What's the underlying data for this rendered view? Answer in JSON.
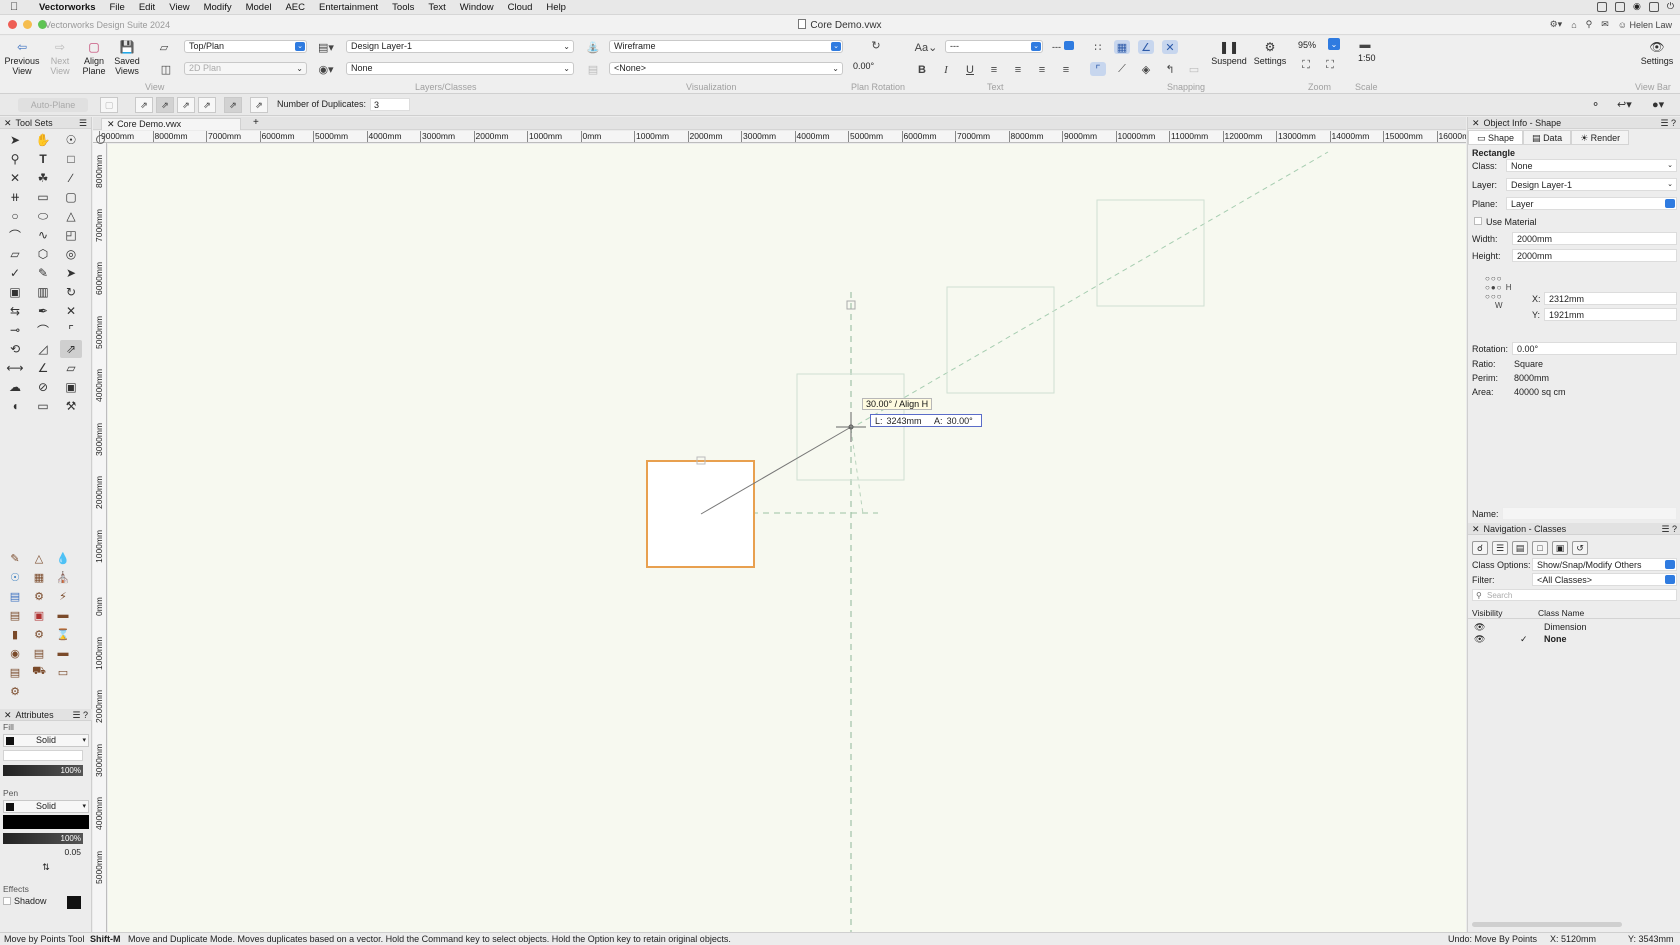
{
  "menubar": {
    "app": "Vectorworks",
    "items": [
      "File",
      "Edit",
      "View",
      "Modify",
      "Model",
      "AEC",
      "Entertainment",
      "Tools",
      "Text",
      "Window",
      "Cloud",
      "Help"
    ]
  },
  "window": {
    "app_name": "Vectorworks Design Suite 2024",
    "doc_title": "Core Demo.vwx",
    "user": "Helen Law"
  },
  "toolbar": {
    "previous_view": "Previous View",
    "next_view": "Next View",
    "align_plane": "Align Plane",
    "saved_views": "Saved Views",
    "view_select": "Top/Plan",
    "plane_select": "2D Plan",
    "layer_select": "Design Layer-1",
    "class_select": "None",
    "render_select": "Wireframe",
    "viewport_select": "<None>",
    "plan_rotation": "0.00°",
    "text_style": "---",
    "text_size": "---",
    "suspend": "Suspend",
    "settings": "Settings",
    "zoom_value": "95%",
    "scale_value": "1:50",
    "settings_right": "Settings",
    "group_view": "View",
    "group_layers": "Layers/Classes",
    "group_visualization": "Visualization",
    "group_plan_rotation": "Plan Rotation",
    "group_text": "Text",
    "group_snapping": "Snapping",
    "group_zoom": "Zoom",
    "group_scale": "Scale",
    "group_viewbar": "View Bar"
  },
  "modebar": {
    "auto_plane": "Auto-Plane",
    "dup_label": "Number of Duplicates:",
    "dup_value": "3"
  },
  "tool_sets": {
    "title": "Tool Sets"
  },
  "attributes": {
    "title": "Attributes",
    "fill_label": "Fill",
    "fill_style": "Solid",
    "fill_opacity": "100%",
    "pen_label": "Pen",
    "pen_style": "Solid",
    "pen_opacity": "100%",
    "pen_thickness": "0.05",
    "effects_label": "Effects",
    "shadow_label": "Shadow"
  },
  "drawing": {
    "tab": "Core Demo.vwx",
    "ruler_top": [
      "9000mm",
      "8000mm",
      "7000mm",
      "6000mm",
      "5000mm",
      "4000mm",
      "3000mm",
      "2000mm",
      "1000mm",
      "0mm",
      "1000mm",
      "2000mm",
      "3000mm",
      "4000mm",
      "5000mm",
      "6000mm",
      "7000mm",
      "8000mm",
      "9000mm",
      "10000mm",
      "11000mm",
      "12000mm",
      "13000mm",
      "14000mm",
      "15000mm",
      "16000mm"
    ],
    "ruler_left": [
      "8000mm",
      "7000mm",
      "6000mm",
      "5000mm",
      "4000mm",
      "3000mm",
      "2000mm",
      "1000mm",
      "0mm",
      "1000mm",
      "2000mm",
      "3000mm",
      "4000mm",
      "5000mm"
    ],
    "tip_align": "30.00° / Align H",
    "tip_length_label": "L:",
    "tip_length": "3243mm",
    "tip_angle_label": "A:",
    "tip_angle": "30.00°"
  },
  "object_info": {
    "title": "Object Info - Shape",
    "tab_shape": "Shape",
    "tab_data": "Data",
    "tab_render": "Render",
    "object_type": "Rectangle",
    "class_label": "Class:",
    "class_value": "None",
    "layer_label": "Layer:",
    "layer_value": "Design Layer-1",
    "plane_label": "Plane:",
    "plane_value": "Layer",
    "use_material": "Use Material",
    "width_label": "Width:",
    "width_value": "2000mm",
    "height_label": "Height:",
    "height_value": "2000mm",
    "x_label": "X:",
    "x_value": "2312mm",
    "y_label": "Y:",
    "y_value": "1921mm",
    "ref_h": "H",
    "ref_w": "W",
    "rotation_label": "Rotation:",
    "rotation_value": "0.00°",
    "ratio_label": "Ratio:",
    "ratio_value": "Square",
    "perim_label": "Perim:",
    "perim_value": "8000mm",
    "area_label": "Area:",
    "area_value": "40000 sq cm",
    "name_label": "Name:"
  },
  "navigation": {
    "title": "Navigation - Classes",
    "class_options_label": "Class Options:",
    "class_options_value": "Show/Snap/Modify Others",
    "filter_label": "Filter:",
    "filter_value": "<All Classes>",
    "search_placeholder": "Search",
    "col_visibility": "Visibility",
    "col_class_name": "Class Name",
    "rows": [
      {
        "name": "Dimension",
        "active": false
      },
      {
        "name": "None",
        "active": true
      }
    ]
  },
  "status": {
    "tool": "Move by Points Tool",
    "shortcut": "Shift-M",
    "message": "Move and Duplicate Mode. Moves duplicates based on a vector. Hold the Command key to select objects. Hold the Option key to retain original objects.",
    "undo": "Undo: Move By Points",
    "x": "X: 5120mm",
    "y": "Y: 3543mm"
  },
  "colors": {
    "selection_orange": "#e8a04f",
    "accent_blue": "#2f7be0",
    "canvas_bg": "#f7f9f0",
    "guide_green": "#9cc4a4"
  }
}
